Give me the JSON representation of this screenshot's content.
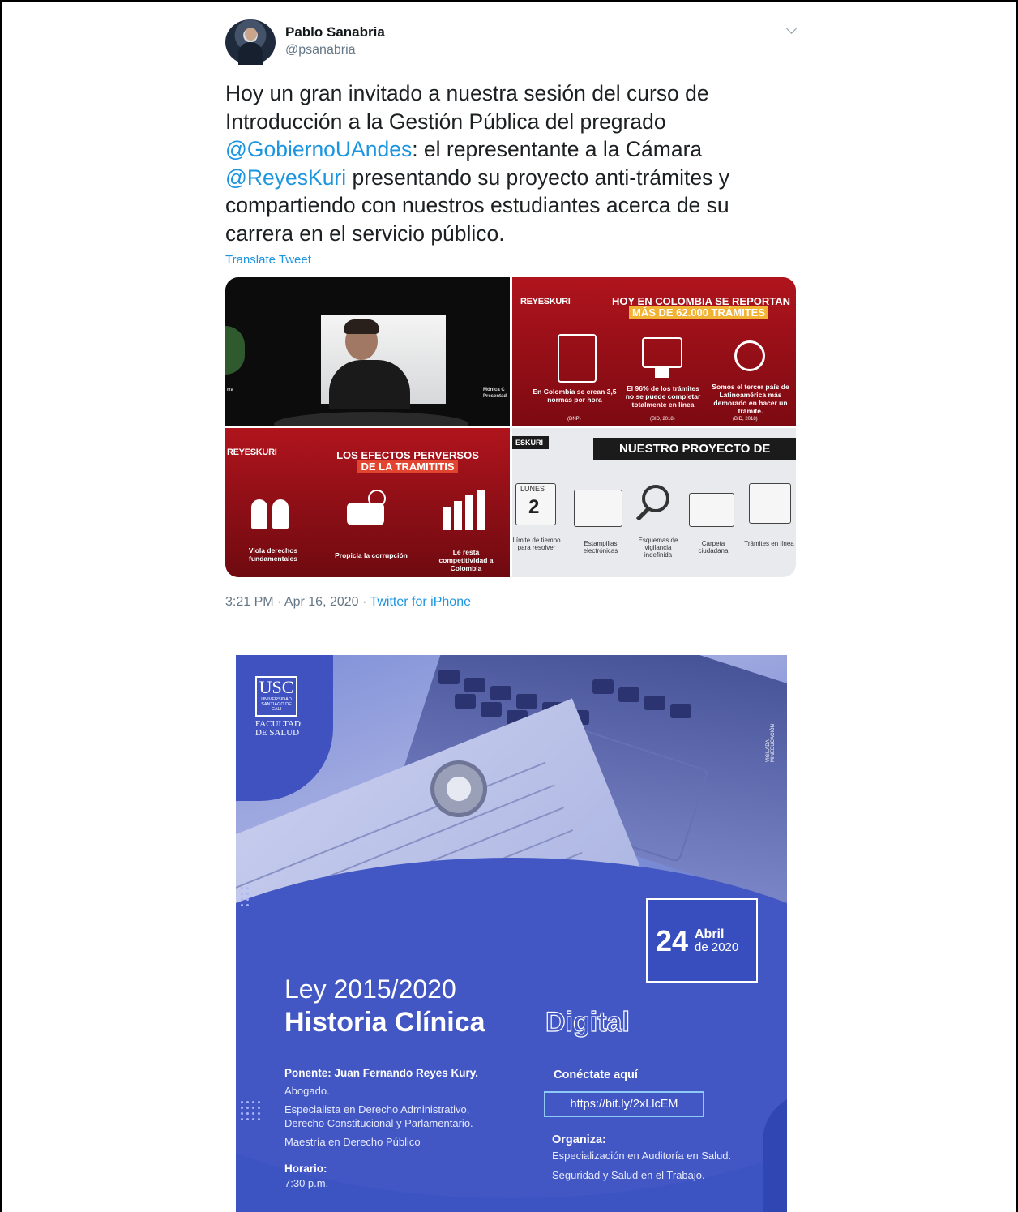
{
  "tweet": {
    "author_name": "Pablo Sanabria",
    "author_handle": "@psanabria",
    "text_part1": "Hoy un gran invitado a nuestra sesión del curso de Introducción a la Gestión Pública del pregrado ",
    "mention1": "@GobiernoUAndes",
    "text_part2": ": el representante a la Cámara ",
    "mention2": "@ReyesKuri",
    "text_part3": " presentando su proyecto anti-trámites y compartiendo con nuestros estudiantes acerca de su carrera en el servicio público.",
    "translate_label": "Translate Tweet",
    "timestamp": "3:21 PM · Apr 16, 2020 · ",
    "source": "Twitter for iPhone",
    "icons": {
      "menu": "chevron-down-icon",
      "avatar": "profile-photo"
    }
  },
  "media": {
    "video": {
      "left_text": "rra",
      "right_text1": "Mónica C",
      "right_text2": "Presentad"
    },
    "slide1": {
      "logo": "REYESKURI",
      "headline1": "HOY EN COLOMBIA SE REPORTAN",
      "headline2": "MÁS DE 62.000 TRÁMITES",
      "cap1": "En Colombia se crean 3,5 normas por hora",
      "cap2": "El 96% de los trámites no se puede completar totalmente en línea",
      "cap3": "Somos el tercer país de Latinoamérica más demorado en hacer un trámite.",
      "src1": "(DNP)",
      "src2": "(BID, 2018)",
      "src3": "(BID, 2018)"
    },
    "slide2": {
      "logo": "REYESKURI",
      "headline1": "LOS EFECTOS PERVERSOS",
      "headline2": "DE LA TRAMITITIS",
      "cap1": "Viola derechos fundamentales",
      "cap2": "Propicia la corrupción",
      "cap3": "Le resta competitividad a Colombia"
    },
    "slide3": {
      "logo": "ESKURI",
      "banner": "NUESTRO PROYECTO DE",
      "day_label": "LUNES",
      "day_num": "2",
      "items": [
        "Límite de tiempo para resolver",
        "Estampillas electrónicas",
        "Esquemas de vigilancia indefinida",
        "Carpeta ciudadana",
        "Trámites en línea"
      ]
    }
  },
  "poster": {
    "usc": "USC",
    "usc_sub": "UNIVERSIDAD SANTIAGO DE CALI",
    "faculty1": "FACULTAD",
    "faculty2": "DE SALUD",
    "vigilada": "VIGILADA MINEDUCACIÓN",
    "day": "24",
    "month": "Abril",
    "year": "de 2020",
    "law": "Ley 2015/2020",
    "title": "Historia Clínica",
    "title_outline": "Digital",
    "speaker": "Ponente: Juan Fernando Reyes Kury.",
    "speaker_lines": [
      "Abogado.",
      "Especialista en Derecho Administrativo,",
      "Derecho Constitucional y Parlamentario.",
      "Maestría en Derecho Público"
    ],
    "schedule_label": "Horario:",
    "schedule_value": "7:30 p.m.",
    "connect_label": "Conéctate aquí",
    "url": "https://bit.ly/2xLlcEM",
    "organizer_label": "Organiza:",
    "organizer_lines": [
      "Especialización en Auditoría en Salud.",
      "Seguridad y Salud en el Trabajo."
    ]
  }
}
